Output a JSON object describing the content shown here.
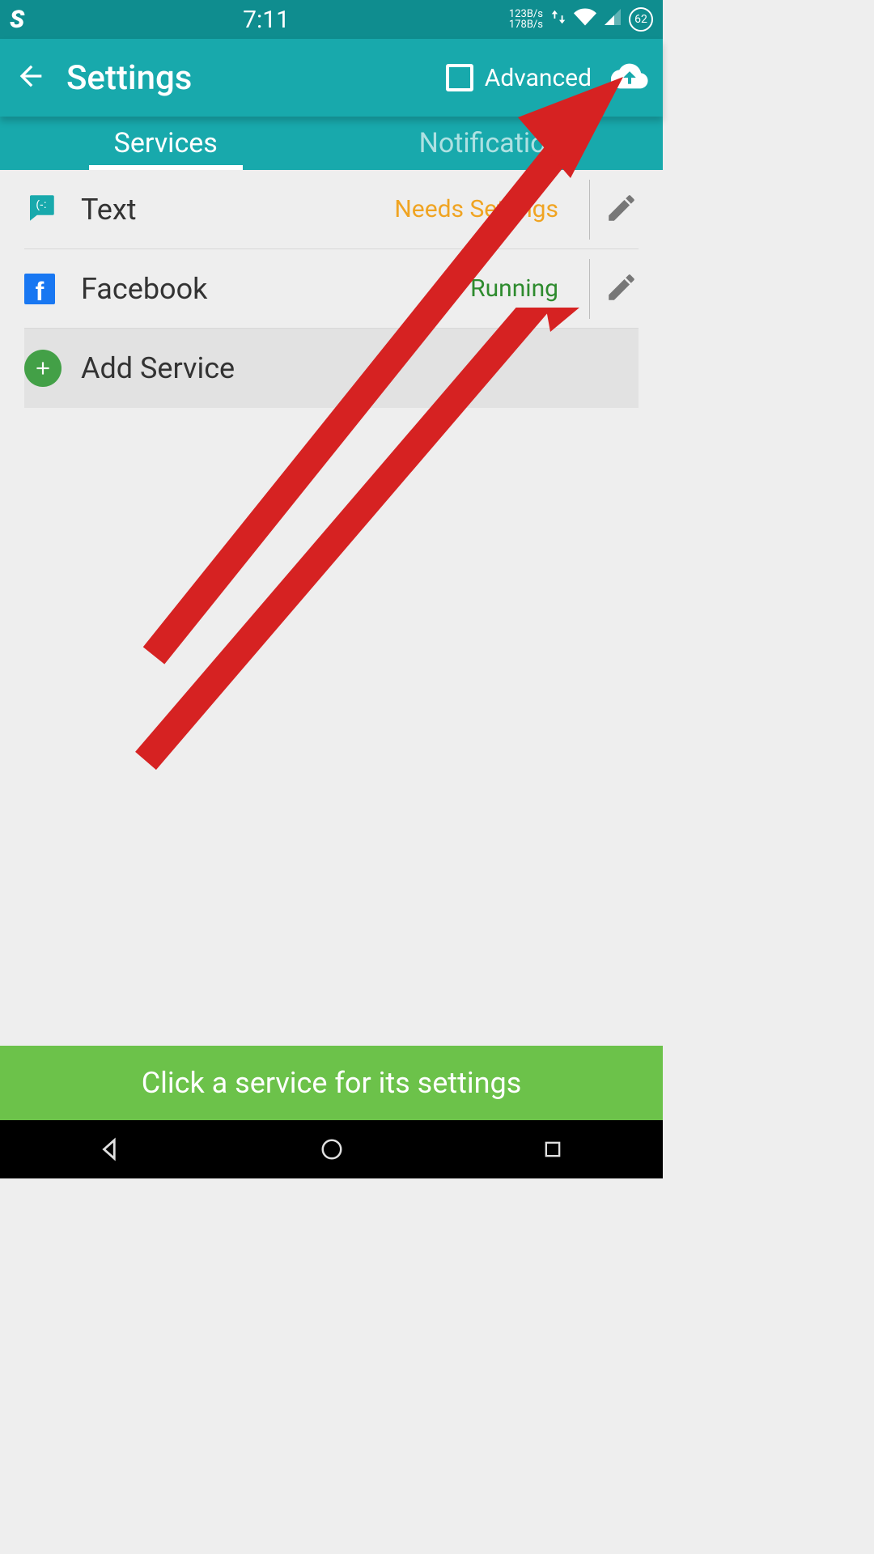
{
  "status": {
    "clock": "7:11",
    "net_up": "123B/s",
    "net_dn": "178B/s",
    "battery": "62"
  },
  "appbar": {
    "title": "Settings",
    "advanced_label": "Advanced"
  },
  "tabs": {
    "services": "Services",
    "notifications": "Notifications"
  },
  "services": [
    {
      "name": "Text",
      "status": "Needs Settings",
      "status_kind": "warn"
    },
    {
      "name": "Facebook",
      "status": "Running",
      "status_kind": "ok"
    }
  ],
  "add_service_label": "Add Service",
  "hint": "Click a service for its settings"
}
